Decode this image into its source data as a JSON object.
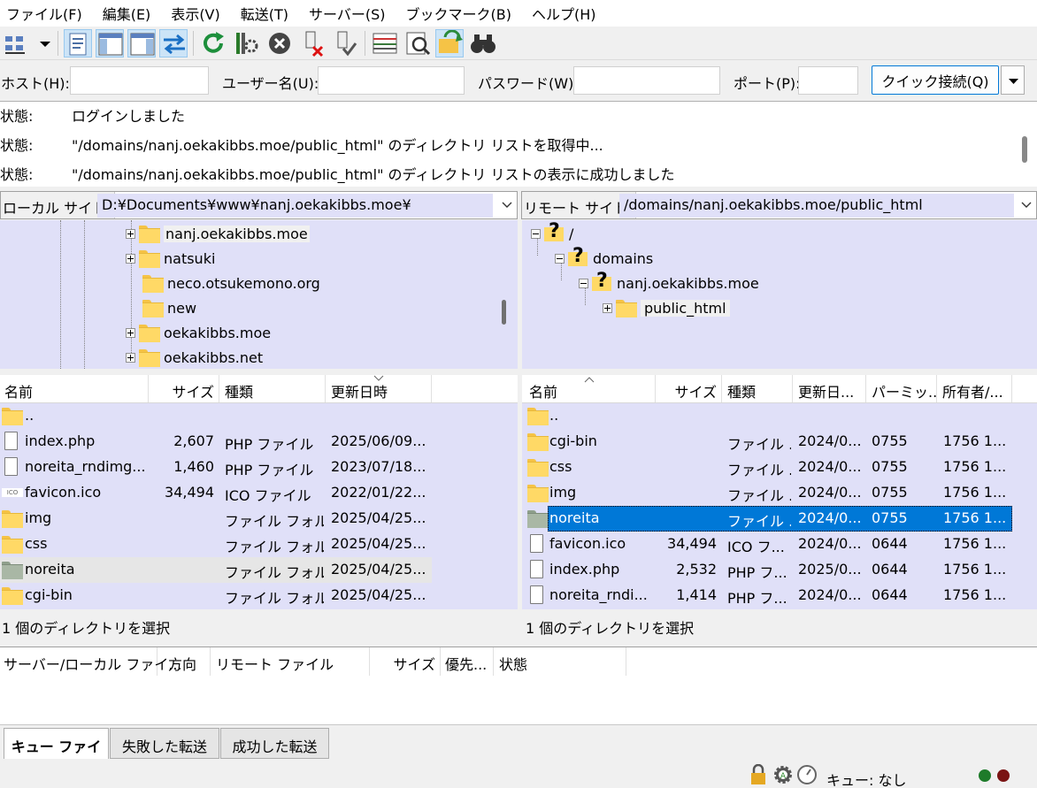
{
  "menu": [
    "ファイル(F)",
    "編集(E)",
    "表示(V)",
    "転送(T)",
    "サーバー(S)",
    "ブックマーク(B)",
    "ヘルプ(H)"
  ],
  "toolbar": {
    "icons": [
      "site-manager-icon",
      "dropdown-arrow-icon",
      "toggle-log-icon",
      "toggle-local-tree-icon",
      "toggle-remote-tree-icon",
      "toggle-queue-icon",
      "refresh-icon",
      "process-queue-icon",
      "cancel-icon",
      "disconnect-icon",
      "reconnect-icon",
      "directory-filter-icon",
      "compare-icon",
      "sync-browse-icon",
      "search-icon"
    ]
  },
  "quickconnect": {
    "host_label": "ホスト(H):",
    "user_label": "ユーザー名(U):",
    "pass_label": "パスワード(W):",
    "port_label": "ポート(P):",
    "host_value": "",
    "user_value": "",
    "pass_value": "",
    "port_value": "",
    "button_label": "クイック接続(Q)"
  },
  "log": [
    {
      "label": "状態:",
      "msg": "ログインしました"
    },
    {
      "label": "状態:",
      "msg": "\"/domains/nanj.oekakibbs.moe/public_html\" のディレクトリ リストを取得中..."
    },
    {
      "label": "状態:",
      "msg": "\"/domains/nanj.oekakibbs.moe/public_html\" のディレクトリ リストの表示に成功しました"
    }
  ],
  "local": {
    "site_label": "ローカル サイト:",
    "site_path": "D:¥Documents¥www¥nanj.oekakibbs.moe¥",
    "tree": [
      {
        "name": "nanj.oekakibbs.moe",
        "expandable": true
      },
      {
        "name": "natsuki",
        "expandable": true
      },
      {
        "name": "neco.otsukemono.org",
        "expandable": false
      },
      {
        "name": "new",
        "expandable": false
      },
      {
        "name": "oekakibbs.moe",
        "expandable": true
      },
      {
        "name": "oekakibbs.net",
        "expandable": true
      }
    ],
    "columns": [
      "名前",
      "サイズ",
      "種類",
      "更新日時"
    ],
    "files": [
      {
        "name": "..",
        "size": "",
        "type": "",
        "date": "",
        "icon": "folder"
      },
      {
        "name": "index.php",
        "size": "2,607",
        "type": "PHP ファイル",
        "date": "2025/06/09...",
        "icon": "file"
      },
      {
        "name": "noreita_rndimg...",
        "size": "1,460",
        "type": "PHP ファイル",
        "date": "2023/07/18...",
        "icon": "file"
      },
      {
        "name": "favicon.ico",
        "size": "34,494",
        "type": "ICO ファイル",
        "date": "2022/01/22...",
        "icon": "ico"
      },
      {
        "name": "img",
        "size": "",
        "type": "ファイル フォル...",
        "date": "2025/04/25...",
        "icon": "folder"
      },
      {
        "name": "css",
        "size": "",
        "type": "ファイル フォル...",
        "date": "2025/04/25...",
        "icon": "folder"
      },
      {
        "name": "noreita",
        "size": "",
        "type": "ファイル フォル...",
        "date": "2025/04/25...",
        "icon": "folder-grey"
      },
      {
        "name": "cgi-bin",
        "size": "",
        "type": "ファイル フォル...",
        "date": "2025/04/25...",
        "icon": "folder"
      }
    ],
    "status": "1 個のディレクトリを選択"
  },
  "remote": {
    "site_label": "リモート サイト:",
    "site_path": "/domains/nanj.oekakibbs.moe/public_html",
    "tree": [
      {
        "name": "/",
        "depth": 0
      },
      {
        "name": "domains",
        "depth": 1
      },
      {
        "name": "nanj.oekakibbs.moe",
        "depth": 2
      },
      {
        "name": "public_html",
        "depth": 3
      }
    ],
    "columns": [
      "名前",
      "サイズ",
      "種類",
      "更新日...",
      "パーミッ...",
      "所有者/..."
    ],
    "files": [
      {
        "name": "..",
        "size": "",
        "type": "",
        "date": "",
        "perm": "",
        "owner": "",
        "icon": "folder"
      },
      {
        "name": "cgi-bin",
        "size": "",
        "type": "ファイル ...",
        "date": "2024/0...",
        "perm": "0755",
        "owner": "1756 1...",
        "icon": "folder"
      },
      {
        "name": "css",
        "size": "",
        "type": "ファイル ...",
        "date": "2024/0...",
        "perm": "0755",
        "owner": "1756 1...",
        "icon": "folder"
      },
      {
        "name": "img",
        "size": "",
        "type": "ファイル ...",
        "date": "2024/0...",
        "perm": "0755",
        "owner": "1756 1...",
        "icon": "folder"
      },
      {
        "name": "noreita",
        "size": "",
        "type": "ファイル ...",
        "date": "2024/0...",
        "perm": "0755",
        "owner": "1756 1...",
        "icon": "folder-grey"
      },
      {
        "name": "favicon.ico",
        "size": "34,494",
        "type": "ICO フ...",
        "date": "2024/0...",
        "perm": "0644",
        "owner": "1756 1...",
        "icon": "file"
      },
      {
        "name": "index.php",
        "size": "2,532",
        "type": "PHP フ...",
        "date": "2025/0...",
        "perm": "0644",
        "owner": "1756 1...",
        "icon": "file"
      },
      {
        "name": "noreita_rndi...",
        "size": "1,414",
        "type": "PHP フ...",
        "date": "2024/0...",
        "perm": "0644",
        "owner": "1756 1...",
        "icon": "file"
      }
    ],
    "status": "1 個のディレクトリを選択"
  },
  "queue": {
    "columns": [
      "サーバー/ローカル ファイ...",
      "方向",
      "リモート ファイル",
      "サイズ",
      "優先...",
      "状態"
    ],
    "tabs": [
      "キュー ファイル",
      "失敗した転送",
      "成功した転送"
    ]
  },
  "statusbar": {
    "queue_text": "キュー: なし",
    "icons": [
      "lock-icon",
      "gear-icon",
      "speed-limit-icon",
      "activity-green-icon",
      "activity-red-icon"
    ]
  },
  "colors": {
    "accent": "#0078d7",
    "list_bg": "#e0e0f8",
    "selected": "#0078d7"
  }
}
